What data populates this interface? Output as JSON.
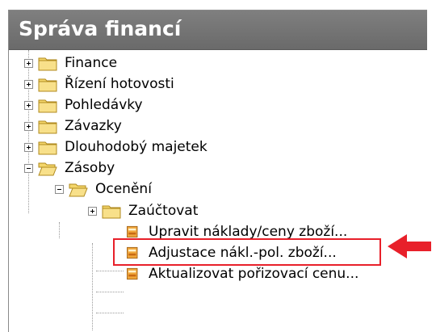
{
  "panel": {
    "title": "Správa financí"
  },
  "tree": {
    "items": [
      {
        "label": "Finance",
        "expander": "plus",
        "icon": "folder-closed-icon"
      },
      {
        "label": "Řízení hotovosti",
        "expander": "plus",
        "icon": "folder-closed-icon"
      },
      {
        "label": "Pohledávky",
        "expander": "plus",
        "icon": "folder-closed-icon"
      },
      {
        "label": "Závazky",
        "expander": "plus",
        "icon": "folder-closed-icon"
      },
      {
        "label": "Dlouhodobý majetek",
        "expander": "plus",
        "icon": "folder-closed-icon"
      },
      {
        "label": "Zásoby",
        "expander": "minus",
        "icon": "folder-open-icon"
      },
      {
        "label": "Ocenění",
        "expander": "minus",
        "icon": "folder-open-icon"
      },
      {
        "label": "Zaúčtovat",
        "expander": "plus",
        "icon": "folder-closed-icon"
      },
      {
        "label": "Upravit náklady/ceny zboží...",
        "icon": "form-icon"
      },
      {
        "label": "Adjustace nákl.-pol. zboží...",
        "icon": "form-icon",
        "highlighted": true
      },
      {
        "label": "Aktualizovat pořizovací cenu...",
        "icon": "form-icon"
      }
    ]
  },
  "colors": {
    "header": "#777777",
    "highlight": "#e8202a",
    "folder": "#f4d66b"
  }
}
